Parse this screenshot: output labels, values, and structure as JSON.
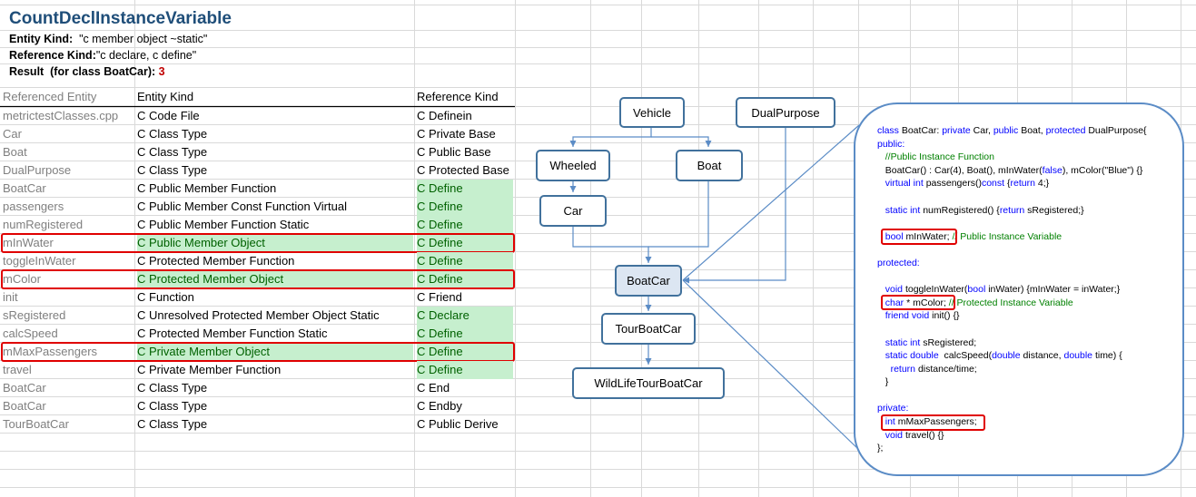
{
  "header": {
    "title": "CountDeclInstanceVariable",
    "entity_kind_label": "Entity Kind:",
    "entity_kind_value": "\"c member object ~static\"",
    "reference_kind_label": "Reference Kind:",
    "reference_kind_value": "\"c declare, c define\"",
    "result_label": "Result  (for class BoatCar):",
    "result_value": "3"
  },
  "table": {
    "columns": [
      "Referenced Entity",
      "Entity Kind",
      "Reference Kind"
    ],
    "rows": [
      {
        "entity": "metrictestClasses.cpp",
        "kind": "C Code File",
        "ref": "C Definein",
        "highlight_kind": false,
        "highlight_ref": false,
        "boxed": false
      },
      {
        "entity": "Car",
        "kind": "C Class Type",
        "ref": "C Private Base",
        "highlight_kind": false,
        "highlight_ref": false,
        "boxed": false
      },
      {
        "entity": "Boat",
        "kind": "C Class Type",
        "ref": "C Public Base",
        "highlight_kind": false,
        "highlight_ref": false,
        "boxed": false
      },
      {
        "entity": "DualPurpose",
        "kind": "C Class Type",
        "ref": "C Protected Base",
        "highlight_kind": false,
        "highlight_ref": false,
        "boxed": false
      },
      {
        "entity": "BoatCar",
        "kind": "C Public Member Function",
        "ref": "C Define",
        "highlight_kind": false,
        "highlight_ref": true,
        "boxed": false
      },
      {
        "entity": "passengers",
        "kind": "C Public Member Const Function Virtual",
        "ref": "C Define",
        "highlight_kind": false,
        "highlight_ref": true,
        "boxed": false
      },
      {
        "entity": "numRegistered",
        "kind": "C Public Member Function Static",
        "ref": "C Define",
        "highlight_kind": false,
        "highlight_ref": true,
        "boxed": false
      },
      {
        "entity": "mInWater",
        "kind": "C Public Member Object",
        "ref": "C Define",
        "highlight_kind": true,
        "highlight_ref": true,
        "boxed": true
      },
      {
        "entity": "toggleInWater",
        "kind": "C Protected Member Function",
        "ref": "C Define",
        "highlight_kind": false,
        "highlight_ref": true,
        "boxed": false
      },
      {
        "entity": "mColor",
        "kind": "C Protected Member Object",
        "ref": "C Define",
        "highlight_kind": true,
        "highlight_ref": true,
        "boxed": true
      },
      {
        "entity": "init",
        "kind": "C Function",
        "ref": "C Friend",
        "highlight_kind": false,
        "highlight_ref": false,
        "boxed": false
      },
      {
        "entity": "sRegistered",
        "kind": "C Unresolved Protected Member Object Static",
        "ref": "C Declare",
        "highlight_kind": false,
        "highlight_ref": true,
        "boxed": false
      },
      {
        "entity": "calcSpeed",
        "kind": "C Protected Member Function Static",
        "ref": "C Define",
        "highlight_kind": false,
        "highlight_ref": true,
        "boxed": false
      },
      {
        "entity": "mMaxPassengers",
        "kind": "C Private Member Object",
        "ref": "C Define",
        "highlight_kind": true,
        "highlight_ref": true,
        "boxed": true
      },
      {
        "entity": "travel",
        "kind": "C Private Member Function",
        "ref": "C Define",
        "highlight_kind": false,
        "highlight_ref": true,
        "boxed": false
      },
      {
        "entity": "BoatCar",
        "kind": "C Class Type",
        "ref": "C End",
        "highlight_kind": false,
        "highlight_ref": false,
        "boxed": false
      },
      {
        "entity": "BoatCar",
        "kind": "C Class Type",
        "ref": "C Endby",
        "highlight_kind": false,
        "highlight_ref": false,
        "boxed": false
      },
      {
        "entity": "TourBoatCar",
        "kind": "C Class Type",
        "ref": "C Public Derive",
        "highlight_kind": false,
        "highlight_ref": false,
        "boxed": false
      }
    ]
  },
  "diagram": {
    "nodes": {
      "vehicle": "Vehicle",
      "dualpurpose": "DualPurpose",
      "wheeled": "Wheeled",
      "boat": "Boat",
      "car": "Car",
      "boatcar": "BoatCar",
      "tourboatcar": "TourBoatCar",
      "wildlife": "WildLifeTourBoatCar"
    }
  },
  "code": {
    "lines": [
      [
        [
          "kw",
          "class "
        ],
        [
          "n",
          "BoatCar: "
        ],
        [
          "kw",
          "private "
        ],
        [
          "n",
          "Car, "
        ],
        [
          "kw",
          "public "
        ],
        [
          "n",
          "Boat, "
        ],
        [
          "kw",
          "protected "
        ],
        [
          "n",
          "DualPurpose{"
        ]
      ],
      [
        [
          "kw",
          "public:"
        ]
      ],
      [
        [
          "cm",
          "   //Public Instance Function"
        ]
      ],
      [
        [
          "n",
          "   BoatCar() : Car(4), Boat(), mInWater("
        ],
        [
          "kw",
          "false"
        ],
        [
          "n",
          "), mColor(\"Blue\") {}"
        ]
      ],
      [
        [
          "kw",
          "   virtual int "
        ],
        [
          "n",
          "passengers()"
        ],
        [
          "kw",
          "const "
        ],
        [
          "n",
          "{"
        ],
        [
          "kw",
          "return "
        ],
        [
          "n",
          "4;}"
        ]
      ],
      [
        [
          "n",
          ""
        ]
      ],
      [
        [
          "kw",
          "   static int "
        ],
        [
          "n",
          "numRegistered() {"
        ],
        [
          "kw",
          "return "
        ],
        [
          "n",
          "sRegistered;}"
        ]
      ],
      [
        [
          "n",
          ""
        ]
      ],
      [
        [
          "kw",
          "   bool "
        ],
        [
          "n",
          "mInWater;"
        ],
        [
          "cm",
          " // Public Instance Variable"
        ]
      ],
      [
        [
          "n",
          ""
        ]
      ],
      [
        [
          "kw",
          "protected:"
        ]
      ],
      [
        [
          "n",
          ""
        ]
      ],
      [
        [
          "kw",
          "   void "
        ],
        [
          "n",
          "toggleInWater("
        ],
        [
          "kw",
          "bool "
        ],
        [
          "n",
          "inWater) {mInWater = inWater;}"
        ]
      ],
      [
        [
          "kw",
          "   char "
        ],
        [
          "n",
          "* mColor;"
        ],
        [
          "cm",
          " // Protected Instance Variable"
        ]
      ],
      [
        [
          "kw",
          "   friend void "
        ],
        [
          "n",
          "init() {}"
        ]
      ],
      [
        [
          "n",
          ""
        ]
      ],
      [
        [
          "kw",
          "   static int "
        ],
        [
          "n",
          "sRegistered;"
        ]
      ],
      [
        [
          "kw",
          "   static double  "
        ],
        [
          "n",
          "calcSpeed("
        ],
        [
          "kw",
          "double "
        ],
        [
          "n",
          "distance, "
        ],
        [
          "kw",
          "double "
        ],
        [
          "n",
          "time) {"
        ]
      ],
      [
        [
          "kw",
          "     return "
        ],
        [
          "n",
          "distance/time;"
        ]
      ],
      [
        [
          "n",
          "   }"
        ]
      ],
      [
        [
          "n",
          ""
        ]
      ],
      [
        [
          "kw",
          "private:"
        ]
      ],
      [
        [
          "kw",
          "   int "
        ],
        [
          "n",
          "mMaxPassengers;"
        ]
      ],
      [
        [
          "kw",
          "   void "
        ],
        [
          "n",
          "travel() {}"
        ]
      ],
      [
        [
          "n",
          "};"
        ]
      ]
    ]
  },
  "colors": {
    "title": "#1F4E79",
    "highlight_fill": "#C6EFCE",
    "highlight_text": "#006100",
    "box_red": "#E00000",
    "node_border": "#41719C",
    "keyword": "#0000FF",
    "comment": "#008000"
  }
}
